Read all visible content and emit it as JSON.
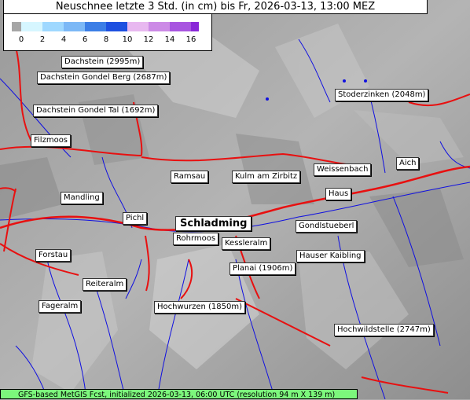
{
  "title": "Neuschnee letzte 3 Std. (in cm) bis Fr, 2026-03-13, 13:00 MEZ",
  "legend": {
    "ticks": [
      "0",
      "2",
      "4",
      "6",
      "8",
      "10",
      "12",
      "14",
      "16"
    ],
    "colors": [
      "#a6a6a6",
      "#d6f6ff",
      "#9fd8ff",
      "#7cb8f6",
      "#3c7ee6",
      "#1e50e0",
      "#e8b8f0",
      "#cc8ae6",
      "#a855e0",
      "#8a28d8"
    ]
  },
  "places": [
    {
      "name": "Dachstein (2995m)"
    },
    {
      "name": "Dachstein Gondel Berg (2687m)"
    },
    {
      "name": "Dachstein Gondel Tal (1692m)"
    },
    {
      "name": "Stoderzinken (2048m)"
    },
    {
      "name": "Filzmoos"
    },
    {
      "name": "Aich"
    },
    {
      "name": "Weissenbach"
    },
    {
      "name": "Ramsau"
    },
    {
      "name": "Kulm am Zirbitz"
    },
    {
      "name": "Mandling"
    },
    {
      "name": "Haus"
    },
    {
      "name": "Pichl"
    },
    {
      "name": "Schladming"
    },
    {
      "name": "Gondlstueberl"
    },
    {
      "name": "Rohrmoos"
    },
    {
      "name": "Kessleralm"
    },
    {
      "name": "Forstau"
    },
    {
      "name": "Hauser Kaibling"
    },
    {
      "name": "Planai (1906m)"
    },
    {
      "name": "Reiteralm"
    },
    {
      "name": "Fageralm"
    },
    {
      "name": "Hochwurzen (1850m)"
    },
    {
      "name": "Hochwildstelle (2747m)"
    }
  ],
  "footer": "GFS-based MetGIS Fcst, initialized 2026-03-13, 06:00 UTC  (resolution 94 m X 139 m)",
  "map_colors": {
    "rivers": "#1010e0",
    "roads": "#e81010",
    "terrain": "#a9a9a9"
  }
}
